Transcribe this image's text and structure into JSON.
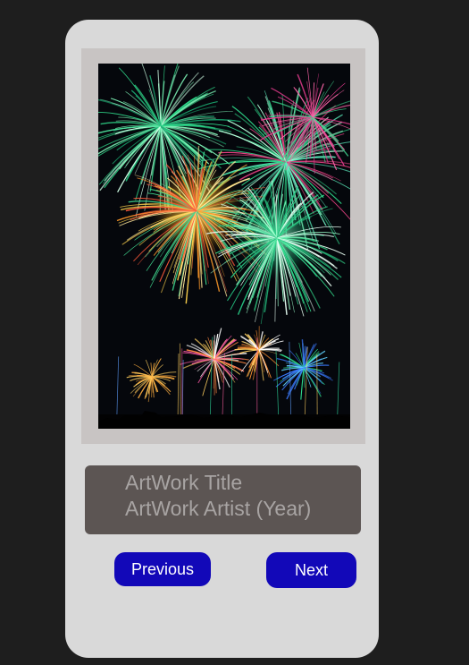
{
  "artwork": {
    "image": "fireworks-night-photo",
    "title": "ArtWork Title",
    "artist": "ArtWork Artist (Year)"
  },
  "controls": {
    "previous_label": "Previous",
    "next_label": "Next"
  },
  "colors": {
    "page_background": "#1e1e1e",
    "device_background": "#d9d9d9",
    "frame_mat": "#c8c4c3",
    "caption_background": "#5c5553",
    "caption_text": "#a8a4a3",
    "button_background": "#1208b8",
    "button_text": "#ffffff"
  }
}
